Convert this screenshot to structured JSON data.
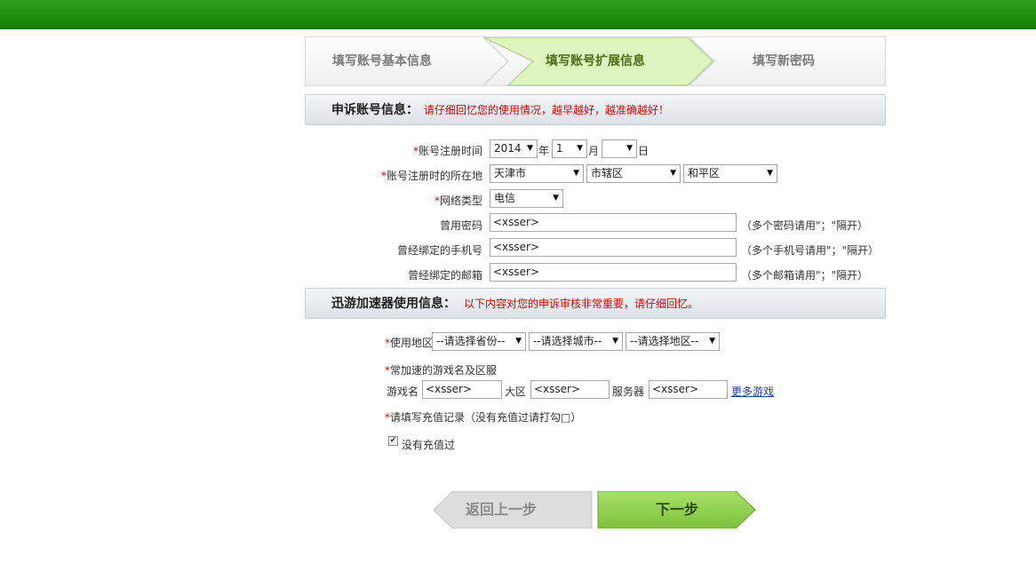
{
  "steps": [
    "填写账号基本信息",
    "填写账号扩展信息",
    "填写新密码"
  ],
  "section1": {
    "title": "申诉账号信息：",
    "note": "请仔细回忆您的使用情况，越早越好，越准确越好！"
  },
  "section2": {
    "title": "迅游加速器使用信息：",
    "note": "以下内容对您的申诉审核非常重要，请仔细回忆。"
  },
  "form": {
    "reg_time_label": "账号注册时间",
    "year": "2014",
    "year_unit": "年",
    "month": "1",
    "month_unit": "月",
    "day": "",
    "day_unit": "日",
    "reg_location_label": "账号注册时的所在地",
    "loc_city": "天津市",
    "loc_district": "市辖区",
    "loc_area": "和平区",
    "network_label": "网络类型",
    "network": "电信",
    "old_pwd_label": "曾用密码",
    "old_pwd": "<xsser>",
    "old_pwd_hint": "（多个密码请用\"；\"隔开）",
    "phone_label": "曾经绑定的手机号",
    "phone": "<xsser>",
    "phone_hint": "（多个手机号请用\"；\"隔开）",
    "email_label": "曾经绑定的邮箱",
    "email": "<xsser>",
    "email_hint": "（多个邮箱请用\"；\"隔开）",
    "use_area_label": "使用地区",
    "province_ph": "--请选择省份--",
    "city_ph": "--请选择城市--",
    "area_ph": "--请选择地区--",
    "games_label": "常加速的游戏名及区服",
    "game_name_label": "游戏名",
    "game_name": "<xsser>",
    "zone_label": "大区",
    "zone": "<xsser>",
    "server_label": "服务器",
    "server": "<xsser>",
    "more_games": "更多游戏",
    "recharge_label": "请填写充值记录（没有充值过请打勾□）",
    "no_recharge_label": "没有充值过"
  },
  "buttons": {
    "back": "返回上一步",
    "next": "下一步"
  },
  "colors": {
    "topbar": "#117f06",
    "active_step": "#e6f7c8",
    "next_btn": "#8ed24a",
    "required": "#dd0000"
  }
}
